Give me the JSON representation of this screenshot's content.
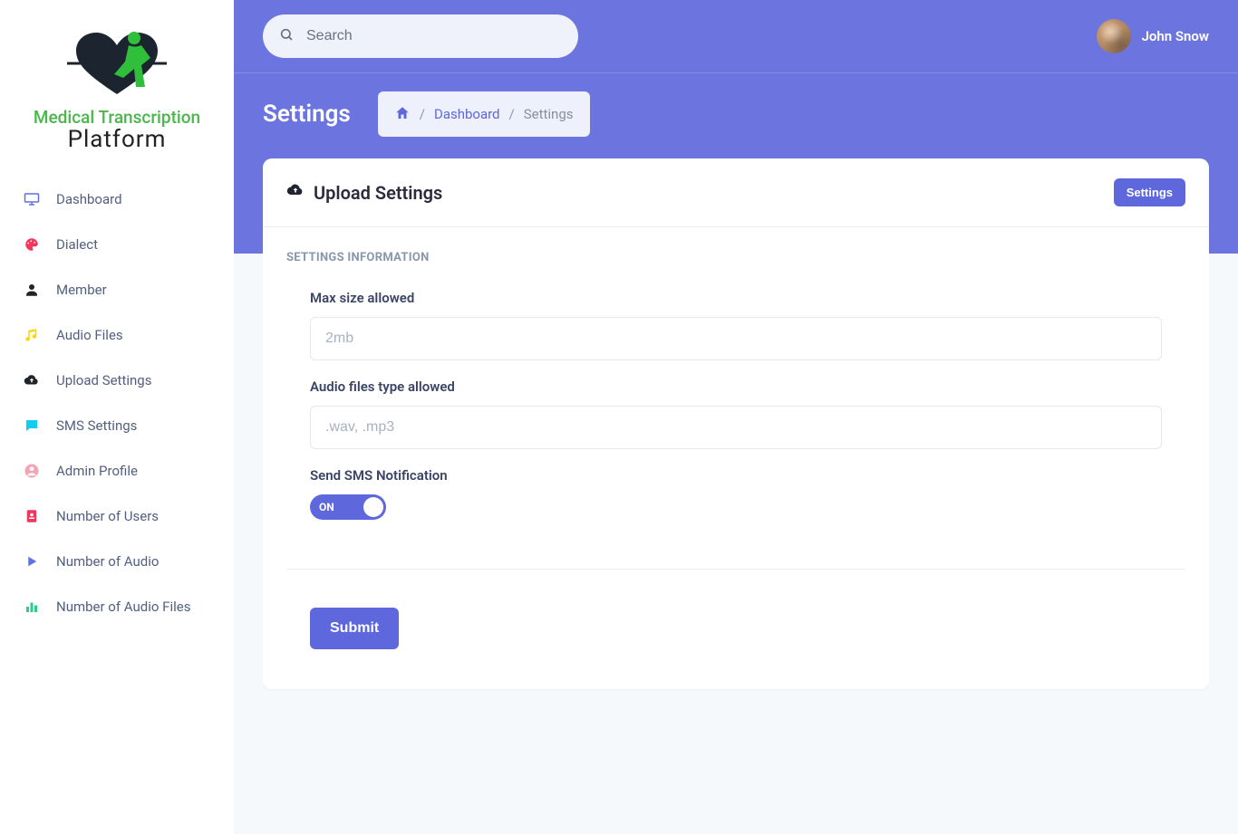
{
  "brand": {
    "line1": "Medical Transcription",
    "line2": "Platform"
  },
  "colors": {
    "accent": "#6C74E0",
    "background_band": "#6C74E0"
  },
  "sidebar": {
    "items": [
      {
        "key": "dashboard",
        "label": "Dashboard",
        "icon": "monitor-icon",
        "color": "#5e72e4"
      },
      {
        "key": "dialect",
        "label": "Dialect",
        "icon": "palette-icon",
        "color": "#f5365c"
      },
      {
        "key": "member",
        "label": "Member",
        "icon": "user-icon",
        "color": "#212529"
      },
      {
        "key": "audio-files",
        "label": "Audio Files",
        "icon": "music-icon",
        "color": "#ffd600"
      },
      {
        "key": "upload-settings",
        "label": "Upload Settings",
        "icon": "cloud-upload-icon",
        "color": "#212529"
      },
      {
        "key": "sms-settings",
        "label": "SMS Settings",
        "icon": "chat-icon",
        "color": "#11cdef"
      },
      {
        "key": "admin-profile",
        "label": "Admin Profile",
        "icon": "avatar-icon",
        "color": "#f3a4b5"
      },
      {
        "key": "num-users",
        "label": "Number of Users",
        "icon": "id-badge-icon",
        "color": "#f5365c"
      },
      {
        "key": "num-audio",
        "label": "Number of Audio",
        "icon": "play-icon",
        "color": "#5e72e4"
      },
      {
        "key": "num-audio-files",
        "label": "Number of Audio Files",
        "icon": "chart-icon",
        "color": "#2dce89"
      }
    ]
  },
  "header": {
    "search_placeholder": "Search",
    "user_name": "John Snow"
  },
  "page": {
    "title": "Settings",
    "breadcrumb": {
      "dashboard": "Dashboard",
      "current": "Settings"
    }
  },
  "card": {
    "title": "Upload Settings",
    "action_label": "Settings",
    "section_heading": "SETTINGS INFORMATION",
    "fields": {
      "max_size": {
        "label": "Max size allowed",
        "value": "2mb"
      },
      "types": {
        "label": "Audio files type allowed",
        "value": ".wav, .mp3"
      },
      "sms": {
        "label": "Send SMS Notification",
        "value": "ON"
      }
    },
    "submit_label": "Submit"
  }
}
